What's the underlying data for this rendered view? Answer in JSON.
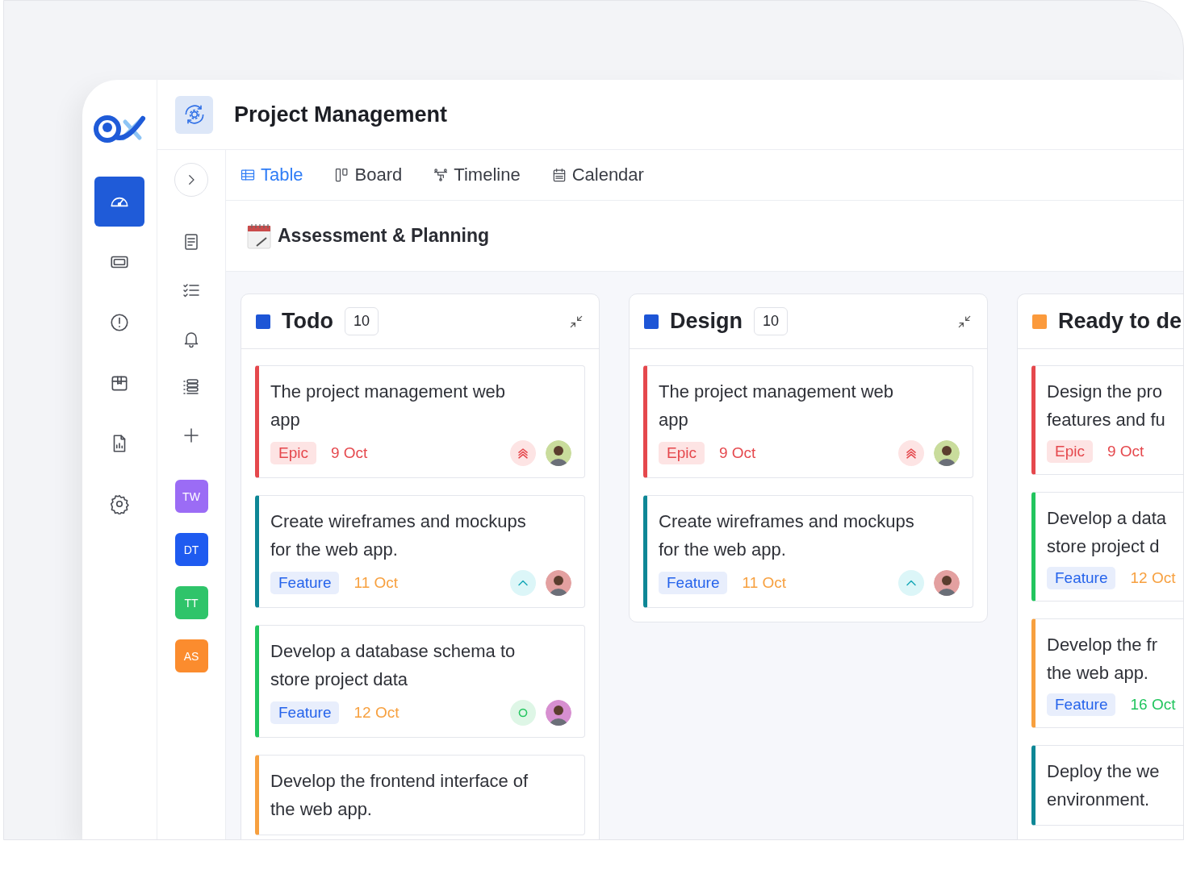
{
  "rail": [
    {
      "kind": "dashboard",
      "selected": true
    },
    {
      "kind": "ticket",
      "selected": false
    },
    {
      "kind": "alert",
      "selected": false
    },
    {
      "kind": "package",
      "selected": false
    },
    {
      "kind": "report",
      "selected": false
    },
    {
      "kind": "settings",
      "selected": false
    }
  ],
  "header": {
    "title": "Project Management"
  },
  "tools": [
    {
      "kind": "document"
    },
    {
      "kind": "checklist"
    },
    {
      "kind": "bell"
    },
    {
      "kind": "list"
    },
    {
      "kind": "add"
    }
  ],
  "workspaces": [
    {
      "label": "TW",
      "color": "#9b6cf5"
    },
    {
      "label": "DT",
      "color": "#1f5bf0"
    },
    {
      "label": "TT",
      "color": "#2fc46a"
    },
    {
      "label": "AS",
      "color": "#fb8c2e"
    }
  ],
  "tabs": [
    {
      "label": "Table",
      "kind": "table",
      "selected": true
    },
    {
      "label": "Board",
      "kind": "board",
      "selected": false
    },
    {
      "label": "Timeline",
      "kind": "timeline",
      "selected": false
    },
    {
      "label": "Calendar",
      "kind": "calendar",
      "selected": false
    }
  ],
  "page_title": "Assessment & Planning",
  "columns": [
    {
      "title": "Todo",
      "color": "#1d55d6",
      "count": "10",
      "collapse": true,
      "cards": [
        {
          "title_lines": [
            "The project management web",
            "app"
          ],
          "color": "#e5484d",
          "tag": {
            "label": "Epic",
            "kind": "epic"
          },
          "date": {
            "text": "9 Oct",
            "color": "#e5484d"
          },
          "priority": {
            "kind": "highest"
          },
          "avatar": {
            "color": "#c9dc9c"
          }
        },
        {
          "title_lines": [
            "Create wireframes and mockups",
            "for the web app."
          ],
          "color": "#0e8796",
          "tag": {
            "label": "Feature",
            "kind": "feature"
          },
          "date": {
            "text": "11 Oct",
            "color": "#f7a03f"
          },
          "priority": {
            "kind": "medium"
          },
          "avatar": {
            "color": "#e3a0a0"
          }
        },
        {
          "title_lines": [
            "Develop a database schema to",
            "store project data"
          ],
          "color": "#22c55e",
          "tag": {
            "label": "Feature",
            "kind": "feature"
          },
          "date": {
            "text": "12 Oct",
            "color": "#f7a03f"
          },
          "priority": {
            "kind": "low"
          },
          "avatar": {
            "color": "#d78fd0"
          }
        },
        {
          "title_lines": [
            "Develop the frontend interface of",
            "the web app."
          ],
          "color": "#f7a03f"
        }
      ]
    },
    {
      "title": "Design",
      "color": "#1d55d6",
      "count": "10",
      "collapse": true,
      "cards": [
        {
          "title_lines": [
            "The project management web",
            "app"
          ],
          "color": "#e5484d",
          "tag": {
            "label": "Epic",
            "kind": "epic"
          },
          "date": {
            "text": "9 Oct",
            "color": "#e5484d"
          },
          "priority": {
            "kind": "highest"
          },
          "avatar": {
            "color": "#c9dc9c"
          }
        },
        {
          "title_lines": [
            "Create wireframes and mockups",
            "for the web app."
          ],
          "color": "#0e8796",
          "tag": {
            "label": "Feature",
            "kind": "feature"
          },
          "date": {
            "text": "11 Oct",
            "color": "#f7a03f"
          },
          "priority": {
            "kind": "medium"
          },
          "avatar": {
            "color": "#e3a0a0"
          }
        }
      ]
    },
    {
      "title": "Ready to de",
      "color": "#fb9a3c",
      "collapse": false,
      "cards": [
        {
          "title_lines": [
            "Design the pro",
            "features and fu"
          ],
          "color": "#e5484d",
          "tag": {
            "label": "Epic",
            "kind": "epic"
          },
          "date": {
            "text": "9 Oct",
            "color": "#e5484d"
          }
        },
        {
          "title_lines": [
            "Develop a data",
            "store project d"
          ],
          "color": "#22c55e",
          "tag": {
            "label": "Feature",
            "kind": "feature"
          },
          "date": {
            "text": "12 Oct",
            "color": "#f7a03f"
          }
        },
        {
          "title_lines": [
            "Develop the fr",
            "the web app."
          ],
          "color": "#f7a03f",
          "tag": {
            "label": "Feature",
            "kind": "feature"
          },
          "date": {
            "text": "16 Oct",
            "color": "#22c55e"
          }
        },
        {
          "title_lines": [
            "Deploy the we",
            "environment."
          ],
          "color": "#0e8796"
        }
      ]
    }
  ]
}
